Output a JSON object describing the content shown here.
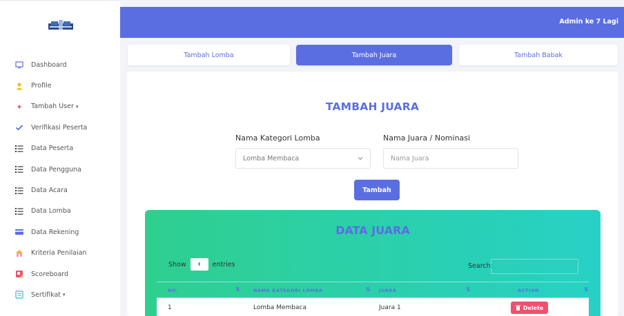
{
  "header": {
    "admin_name": "Admin ke 7 Lagi"
  },
  "sidebar": {
    "items": [
      {
        "label": "Dashboard",
        "icon": "monitor-icon"
      },
      {
        "label": "Profile",
        "icon": "user-icon"
      },
      {
        "label": "Tambah User",
        "icon": "add-user-icon",
        "dropdown": true
      },
      {
        "label": "Verifikasi Peserta",
        "icon": "check-icon"
      },
      {
        "label": "Data Peserta",
        "icon": "list-icon"
      },
      {
        "label": "Data Pengguna",
        "icon": "list-icon"
      },
      {
        "label": "Data Acara",
        "icon": "list-icon"
      },
      {
        "label": "Data Lomba",
        "icon": "list-icon"
      },
      {
        "label": "Data Rekening",
        "icon": "card-icon"
      },
      {
        "label": "Kriteria Penilaian",
        "icon": "building-icon"
      },
      {
        "label": "Scoreboard",
        "icon": "board-icon"
      },
      {
        "label": "Sertifikat",
        "icon": "certificate-icon",
        "dropdown": true
      }
    ],
    "caret": "▾"
  },
  "tabs": [
    {
      "label": "Tambah Lomba",
      "active": false
    },
    {
      "label": "Tambah Juara",
      "active": true
    },
    {
      "label": "Tambah Babak",
      "active": false
    }
  ],
  "form": {
    "title": "TAMBAH JUARA",
    "kategori_label": "Nama Kategori Lomba",
    "kategori_value": "Lomba Membaca",
    "juara_label": "Nama Juara / Nominasi",
    "juara_placeholder": "Nama Juara",
    "submit_label": "Tambah"
  },
  "table": {
    "title": "DATA JUARA",
    "show_label": "Show",
    "entries_label": "entries",
    "search_label": "Search:",
    "columns": [
      "NO.",
      "NAMA KATEGORI LOMBA",
      "JUARA",
      "ACTION"
    ],
    "rows": [
      {
        "no": "1",
        "kategori": "Lomba Membaca",
        "juara": "Juara 1",
        "action": "Delete"
      }
    ]
  },
  "colors": {
    "primary": "#5b6ee1",
    "panel_start": "#2fcf8f",
    "panel_end": "#27d1c6",
    "danger": "#f0506e"
  }
}
